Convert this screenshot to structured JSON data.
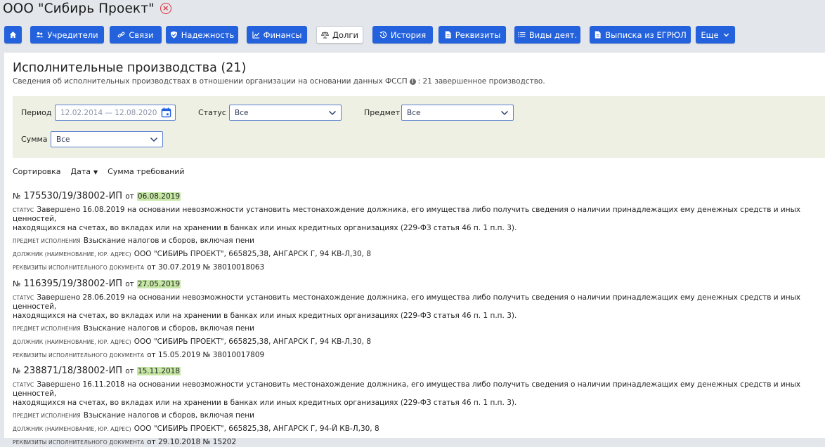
{
  "header": {
    "company_name": "ООО \"Сибирь Проект\"",
    "close_symbol": "×"
  },
  "toolbar": {
    "home_icon": "home-icon",
    "buttons": [
      {
        "label": "Учредители",
        "icon": "users-icon"
      },
      {
        "label": "Связи",
        "icon": "link-icon"
      },
      {
        "label": "Надежность",
        "icon": "shield-icon"
      },
      {
        "label": "Финансы",
        "icon": "chart-icon"
      },
      {
        "label": "Долги",
        "icon": "scales-icon",
        "active": true
      },
      {
        "label": "История",
        "icon": "history-icon"
      },
      {
        "label": "Реквизиты",
        "icon": "document-icon"
      },
      {
        "label": "Виды деят.",
        "icon": "list-icon"
      },
      {
        "label": "Выписка из ЕГРЮЛ",
        "icon": "document-icon"
      },
      {
        "label": "Еще",
        "icon": "chevron-down-icon"
      }
    ],
    "accent_color": "#2462dd"
  },
  "page": {
    "title": "Исполнительные производства (21)",
    "subtitle_prefix": "Сведения об исполнительных производствах в отношении организации на основании данных ФССП",
    "subtitle_suffix": ": 21 завершенное производство.",
    "info_symbol": "!"
  },
  "filters": {
    "period_label": "Период",
    "period_value": "12.02.2014 — 12.08.2020",
    "status_label": "Статус",
    "status_value": "Все",
    "subject_label": "Предмет",
    "subject_value": "Все",
    "sum_label": "Сумма",
    "sum_value": "Все",
    "background_color": "#eef0e3"
  },
  "sort": {
    "label": "Сортировка",
    "by_date": "Дата",
    "by_sum": "Сумма требований"
  },
  "labels": {
    "number_prefix": "№",
    "from": "от",
    "status": "Статус",
    "subject": "Предмет исполнения",
    "debtor": "Должник (наименование, юр. адрес)",
    "requisites": "Реквизиты исполнительного документа"
  },
  "cases": [
    {
      "number": "175530/19/38002-ИП",
      "date": "06.08.2019",
      "status_line1": "Завершено 16.08.2019 на основании невозможности установить местонахождение должника, его имущества либо получить сведения о наличии принадлежащих ему денежных средств и иных ценностей,",
      "status_line2": "находящихся на счетах, во вкладах или на хранении в банках или иных кредитных организациях (229-ФЗ статья 46 п. 1 п.п. 3).",
      "subject": "Взыскание налогов и сборов, включая пени",
      "debtor": "ООО \"СИБИРЬ ПРОЕКТ\", 665825,38, АНГАРСК Г, 94 КВ-Л,30, 8",
      "requisites": "от 30.07.2019 № 38010018063"
    },
    {
      "number": "116395/19/38002-ИП",
      "date": "27.05.2019",
      "status_line1": "Завершено 28.06.2019 на основании невозможности установить местонахождение должника, его имущества либо получить сведения о наличии принадлежащих ему денежных средств и иных ценностей,",
      "status_line2": "находящихся на счетах, во вкладах или на хранении в банках или иных кредитных организациях (229-ФЗ статья 46 п. 1 п.п. 3).",
      "subject": "Взыскание налогов и сборов, включая пени",
      "debtor": "ООО \"СИБИРЬ ПРОЕКТ\", 665825,38, АНГАРСК Г, 94 КВ-Л,30, 8",
      "requisites": "от 15.05.2019 № 38010017809"
    },
    {
      "number": "238871/18/38002-ИП",
      "date": "15.11.2018",
      "status_line1": "Завершено 16.11.2018 на основании невозможности установить местонахождение должника, его имущества либо получить сведения о наличии принадлежащих ему денежных средств и иных ценностей,",
      "status_line2": "находящихся на счетах, во вкладах или на хранении в банках или иных кредитных организациях (229-ФЗ статья 46 п. 1 п.п. 3).",
      "subject": "Взыскание налогов и сборов, включая пени",
      "debtor": "ООО \"СИБИРЬ ПРОЕКТ\", 665825,38, АНГАРСК Г, 94-Й КВ-Л,30, 8",
      "requisites": "от 29.10.2018 № 15202"
    }
  ]
}
